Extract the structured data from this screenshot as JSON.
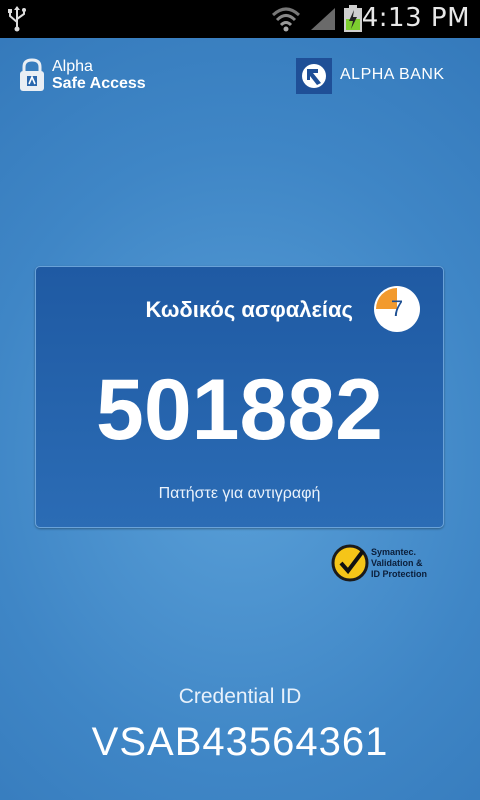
{
  "status_bar": {
    "time": "4:13 PM",
    "icons": [
      "usb-icon",
      "wifi-icon",
      "signal-icon",
      "battery-charging-icon"
    ]
  },
  "header": {
    "app_brand_line1": "Alpha",
    "app_brand_line2": "Safe Access",
    "app_logo_icon": "lock-icon",
    "bank_name": "ALPHA BANK",
    "bank_logo_icon": "alpha-bank-logo-icon"
  },
  "code_card": {
    "title": "Κωδικός ασφαλείας",
    "timer_seconds": "7",
    "timer_icon": "countdown-timer-icon",
    "code": "501882",
    "copy_hint": "Πατήστε για αντιγραφή"
  },
  "symantec": {
    "icon": "checkmark-seal-icon",
    "line1": "Symantec.",
    "line2": "Validation &",
    "line3": "ID Protection"
  },
  "credential": {
    "label": "Credential ID",
    "value": "VSAB43564361"
  },
  "colors": {
    "background_center": "#5aa0d8",
    "background_edge": "#2c6fb2",
    "card": "#2563ad",
    "timer_orange": "#f29a2e",
    "status_bar": "#000000"
  }
}
